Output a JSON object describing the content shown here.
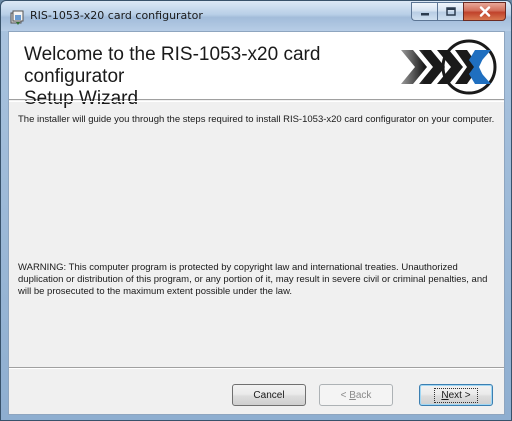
{
  "window": {
    "title": "RIS-1053-x20 card configurator",
    "icon": "installer-icon"
  },
  "caption_buttons": {
    "minimize": "minimize-icon",
    "maximize": "maximize-icon",
    "close": "close-icon"
  },
  "banner": {
    "title_line1": "Welcome to the RIS-1053-x20 card configurator",
    "title_line2": "Setup Wizard",
    "logo": "chevron-x-logo",
    "accent_color": "#1f6fc0"
  },
  "content": {
    "intro": "The installer will guide you through the steps required to install RIS-1053-x20 card configurator on your computer.",
    "warning": "WARNING: This computer program is protected by copyright law and international treaties. Unauthorized duplication or distribution of this program, or any portion of it, may result in severe civil or criminal penalties, and will be prosecuted to the maximum extent possible under the law."
  },
  "buttons": {
    "cancel": "Cancel",
    "back_prefix": "< ",
    "back_key": "B",
    "back_rest": "ack",
    "next_key": "N",
    "next_rest": "ext >"
  }
}
